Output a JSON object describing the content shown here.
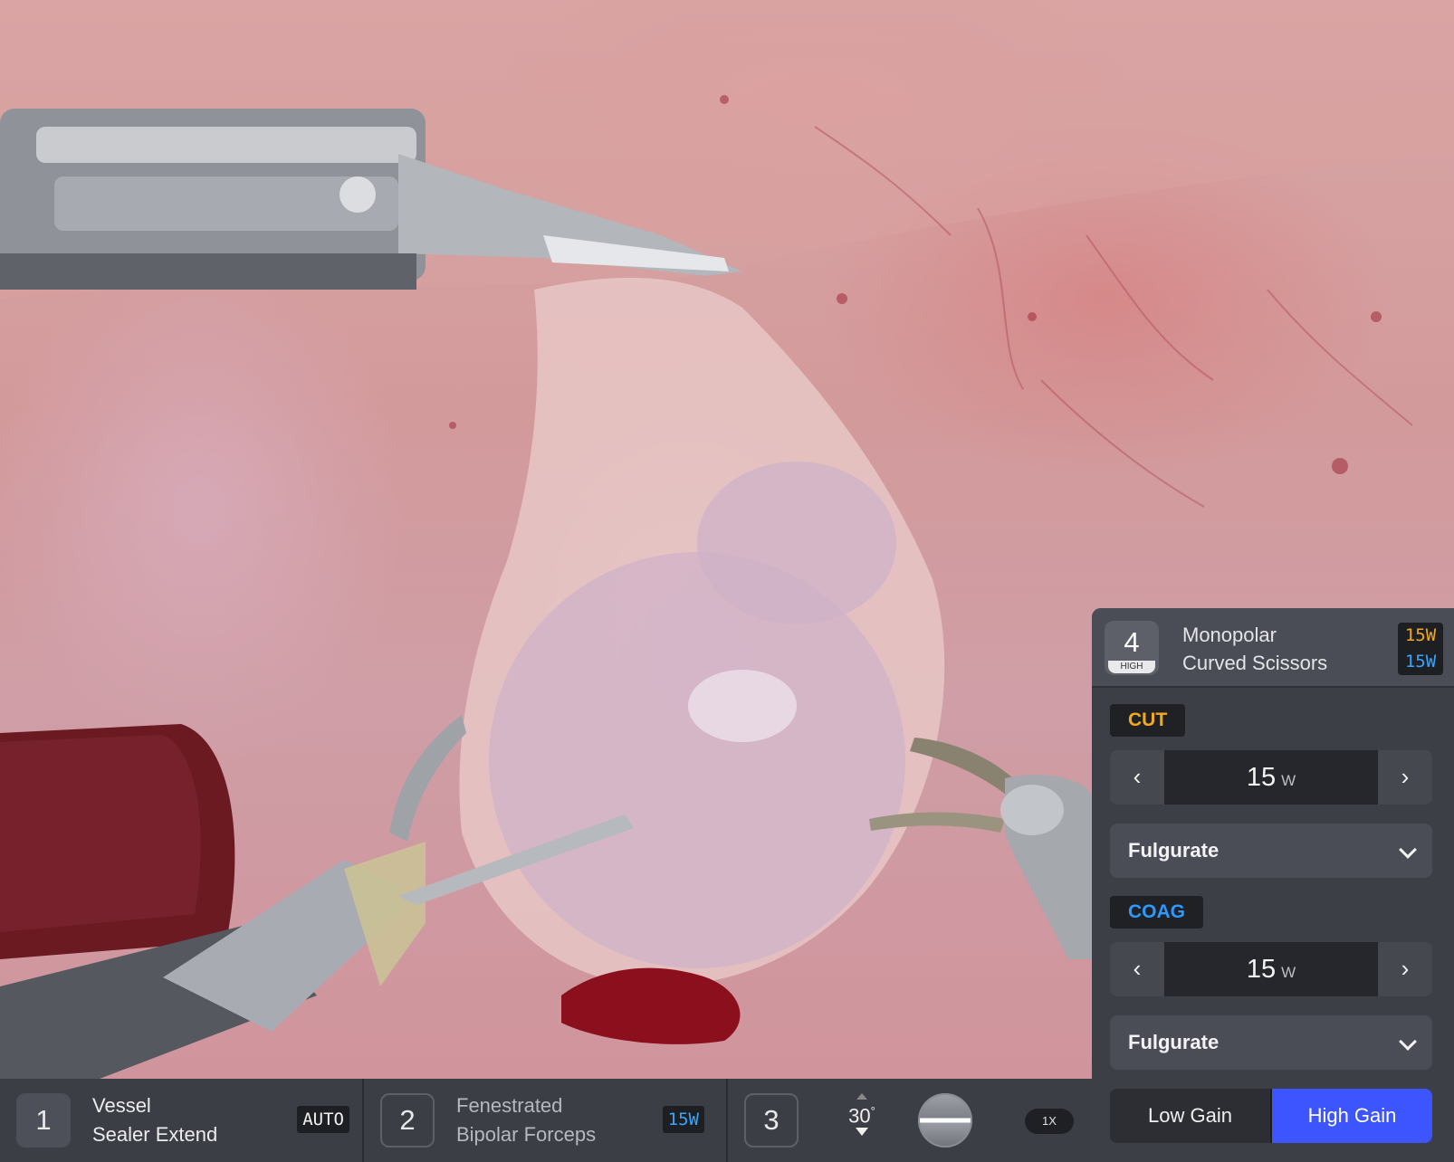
{
  "bottom_bar": {
    "slot1": {
      "number": "1",
      "name_line1": "Vessel",
      "name_line2": "Sealer Extend",
      "badge": "AUTO"
    },
    "slot2": {
      "number": "2",
      "name_line1": "Fenestrated",
      "name_line2": "Bipolar Forceps",
      "badge": "15W"
    },
    "slot3": {
      "number": "3",
      "scope_angle": "30",
      "scope_angle_unit": "°",
      "zoom": "1X"
    }
  },
  "panel": {
    "header": {
      "number": "4",
      "level": "HIGH",
      "name_line1": "Monopolar",
      "name_line2": "Curved Scissors",
      "cut_watts": "15W",
      "coag_watts": "15W"
    },
    "cut": {
      "label": "CUT",
      "value": "15",
      "unit": "W",
      "mode": "Fulgurate"
    },
    "coag": {
      "label": "COAG",
      "value": "15",
      "unit": "W",
      "mode": "Fulgurate"
    },
    "gain": {
      "low_label": "Low Gain",
      "high_label": "High Gain",
      "selected": "High Gain"
    }
  },
  "colors": {
    "cut_accent": "#f2a921",
    "coag_accent": "#2d99ff",
    "selected_gain": "#3d55ff",
    "panel_bg": "#3c3f46"
  },
  "icons": {
    "decrease": "chevron-left-icon",
    "increase": "chevron-right-icon",
    "dropdown": "chevron-down-icon",
    "horizon": "horizon-indicator-icon"
  }
}
